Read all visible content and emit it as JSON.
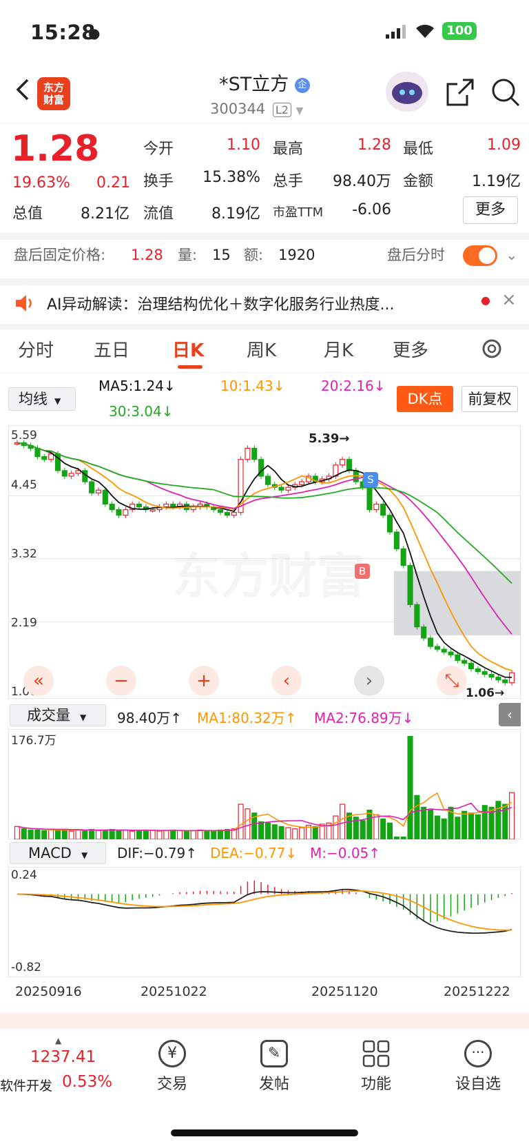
{
  "status": {
    "time": "15:28",
    "battery": "100"
  },
  "nav": {
    "logo_text": "东方财富",
    "stock_name": "*ST立方",
    "badge": "企",
    "code": "300344",
    "level": "L2"
  },
  "quote": {
    "price": "1.28",
    "pct": "19.63%",
    "chg": "0.21",
    "open_label": "今开",
    "open": "1.10",
    "high_label": "最高",
    "high": "1.28",
    "low_label": "最低",
    "low": "1.09",
    "turnover_label": "换手",
    "turnover": "15.38%",
    "vol_label": "总手",
    "vol": "98.40万",
    "amount_label": "金额",
    "amount": "1.19亿",
    "mktcap_label": "总值",
    "mktcap": "8.21亿",
    "float_label": "流值",
    "float": "8.19亿",
    "pe_label": "市盈TTM",
    "pe": "-6.06",
    "more_button": "更多"
  },
  "afterhours": {
    "label": "盘后固定价格:",
    "price": "1.28",
    "vol_label": "量:",
    "vol": "15",
    "amt_label": "额:",
    "amt": "1920",
    "tick_label": "盘后分时"
  },
  "ai": {
    "text": "AI异动解读：治理结构优化＋数字化服务行业热度..."
  },
  "tabs": [
    "分时",
    "五日",
    "日K",
    "周K",
    "月K",
    "更多"
  ],
  "active_tab": "日K",
  "ma_bar": {
    "selector": "均线",
    "ma5": "MA5:1.24↓",
    "ma10": "10:1.43↓",
    "ma20": "20:2.16↓",
    "ma30": "30:3.04↓",
    "dk_button": "DK点",
    "fq_button": "前复权"
  },
  "kline": {
    "y_labels": [
      "5.59",
      "4.45",
      "3.32",
      "2.19",
      "1.06"
    ],
    "high_marker": "5.39→",
    "low_marker": "1.06→",
    "signal_s": "S",
    "signal_b": "B",
    "watermark": "东方财富"
  },
  "volume": {
    "selector": "成交量",
    "value": "98.40万↑",
    "ma1": "MA1:80.32万↑",
    "ma2": "MA2:76.89万↓",
    "max_label": "176.7万"
  },
  "macd": {
    "selector": "MACD",
    "dif": "DIF:−0.79↑",
    "dea": "DEA:−0.77↓",
    "m": "M:−0.05↑",
    "top_label": "0.24",
    "bottom_label": "-0.82"
  },
  "dates": [
    "20250916",
    "20251022",
    "20251120",
    "20251222"
  ],
  "bottom": {
    "index_value": "1237.41",
    "index_name": "软件开发",
    "index_pct": "0.53%",
    "items": [
      "交易",
      "发帖",
      "功能",
      "设自选"
    ]
  },
  "colors": {
    "up": "#e8202a",
    "down": "#14a514",
    "ma5": "#111111",
    "ma10": "#ff9500",
    "ma20": "#e020b0",
    "ma30": "#22aa22",
    "accent": "#e9401d"
  },
  "chart_data": {
    "type": "candlestick",
    "title": "*ST立方 日K",
    "y_range": [
      1.06,
      5.59
    ],
    "x_ticks": [
      "20250916",
      "20251022",
      "20251120",
      "20251222"
    ],
    "close": [
      5.4,
      5.35,
      5.3,
      5.15,
      5.1,
      5.2,
      4.9,
      4.8,
      4.85,
      4.9,
      4.7,
      4.5,
      4.55,
      4.3,
      4.2,
      4.1,
      4.2,
      4.3,
      4.25,
      4.2,
      4.2,
      4.25,
      4.3,
      4.25,
      4.3,
      4.2,
      4.25,
      4.3,
      4.25,
      4.2,
      4.15,
      4.1,
      4.15,
      5.1,
      5.3,
      5.1,
      4.8,
      4.65,
      4.6,
      4.55,
      4.6,
      4.65,
      4.7,
      4.8,
      4.7,
      4.75,
      4.8,
      5.0,
      5.1,
      4.9,
      4.7,
      4.6,
      4.2,
      4.3,
      4.1,
      3.8,
      3.5,
      3.2,
      2.5,
      2.1,
      1.9,
      1.75,
      1.7,
      1.65,
      1.6,
      1.5,
      1.45,
      1.35,
      1.3,
      1.25,
      1.2,
      1.15,
      1.1,
      1.28
    ],
    "ma_last": {
      "MA5": 1.24,
      "MA10": 1.43,
      "MA20": 2.16,
      "MA30": 3.04
    },
    "volume": [
      22,
      18,
      16,
      16,
      15,
      17,
      16,
      17,
      14,
      16,
      15,
      17,
      15,
      16,
      17,
      15,
      16,
      14,
      15,
      16,
      15,
      14,
      15,
      16,
      15,
      14,
      15,
      16,
      15,
      14,
      16,
      17,
      18,
      60,
      52,
      45,
      30,
      28,
      25,
      22,
      20,
      18,
      20,
      24,
      22,
      26,
      28,
      40,
      60,
      45,
      38,
      32,
      50,
      42,
      35,
      28,
      4,
      4,
      176,
      75,
      55,
      50,
      40,
      35,
      55,
      38,
      48,
      45,
      42,
      58,
      55,
      65,
      60,
      80
    ],
    "macd_range": [
      -0.82,
      0.24
    ]
  }
}
